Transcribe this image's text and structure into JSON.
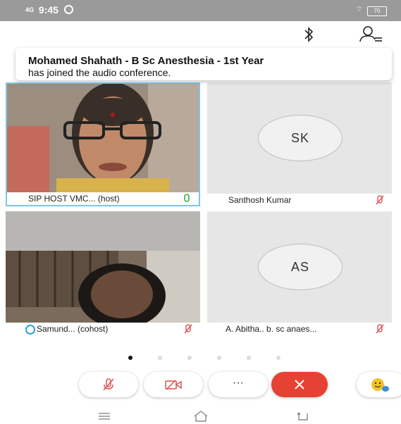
{
  "status_bar": {
    "signal_label": "4G",
    "time": "9:45",
    "battery_label": "70"
  },
  "toast": {
    "name": "Mohamed Shahath - B Sc Anesthesia - 1st Year",
    "message": "has joined the audio conference."
  },
  "participants": [
    {
      "name": "SIP HOST VMC... (host)",
      "initials": "",
      "mic": "on",
      "accent": "#7fc4e4"
    },
    {
      "name": "Santhosh Kumar",
      "initials": "SK",
      "mic": "muted"
    },
    {
      "name": "Samund... (cohost)",
      "initials": "",
      "mic": "muted"
    },
    {
      "name": "A. Abitha.. b. sc anaes...",
      "initials": "AS",
      "mic": "muted"
    }
  ],
  "pager": {
    "total": 6,
    "active_index": 0
  },
  "controls": {
    "more_label": "···",
    "end_color": "#e64233",
    "mic_muted_color": "#d9534f"
  },
  "icons": [
    "bluetooth-icon",
    "participants-icon",
    "mic-muted-icon",
    "video-muted-icon",
    "more-icon",
    "end-call-icon",
    "reaction-icon",
    "menu-icon",
    "home-icon",
    "back-icon"
  ]
}
